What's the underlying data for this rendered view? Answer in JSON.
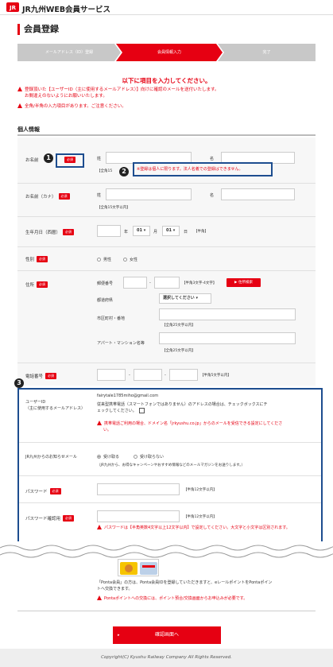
{
  "header": {
    "site_title": "JR九州WEB会員サービス"
  },
  "page": {
    "title": "会員登録"
  },
  "steps": [
    {
      "label": "メールアドレス（ID）登録"
    },
    {
      "label": "会員情報入力"
    },
    {
      "label": "完了"
    }
  ],
  "instruction": "以下に項目を入力してください。",
  "notes": [
    "登録頂いた【ユーザーID（主に使用するメールアドレス）】向けに確認のメールを送付いたします。",
    "お間違えのないようにお願いいたします。",
    "全角/半角の入力項目があります。ご注意ください。"
  ],
  "section": {
    "title": "個人情報"
  },
  "required_badge": "必須",
  "name": {
    "label": "お名前",
    "sei": "姓",
    "mei": "名",
    "hint": "【全角15",
    "warning": "※登録は個人に限ります。法人名義での登録はできません。"
  },
  "name_kana": {
    "label": "お名前（カナ）",
    "sei": "姓",
    "mei": "名",
    "hint": "【全角15文字以内】"
  },
  "birthday": {
    "label": "生年月日（西暦）",
    "year_unit": "年",
    "month": "01",
    "month_unit": "月",
    "day": "01",
    "day_unit": "日",
    "hint": "【半角】"
  },
  "gender": {
    "label": "性別",
    "male": "男性",
    "female": "女性"
  },
  "address": {
    "label": "住所",
    "postal_label": "郵便番号",
    "postal_hint": "【半角3文字-4文字】",
    "search_button": "▶ 住所検索",
    "pref_label": "都道府県",
    "pref_value": "選択してください",
    "city_label": "市区町村・番地",
    "city_hint": "【全角25文字以内】",
    "building_label": "アパート・マンション名等",
    "building_hint": "【全角25文字以内】"
  },
  "phone": {
    "label": "電話番号",
    "hint": "【半角5文字以内】"
  },
  "user_id": {
    "label_line1": "ユーザーID",
    "label_line2": "（主に使用するメールアドレス）",
    "value": "fairytale1785miho@gmail.com",
    "checkbox_text_1": "従来型携帯電話（スマートフォンではありません）のアドレスの場合は、チェックボックスにチ",
    "checkbox_text_2": "ェックしてください。",
    "warning_1": "携帯電話ご利用の場合、ドメイン名「jrkyushu.co.jp」からのメールを受信できる設定にしてくださ",
    "warning_2": "い。"
  },
  "newsletter": {
    "label": "JR九州からのお知らせメール",
    "receive": "受け取る",
    "not_receive": "受け取らない",
    "note": "（JR九州から、お得なキャンペーンやおすすめ情報などのメールマガジンをお送りします。）"
  },
  "password": {
    "label": "パスワード",
    "hint": "【半角12文字以内】"
  },
  "password_confirm": {
    "label": "パスワード確認用",
    "hint": "【半角12文字以内】",
    "warning": "パスワードは【半角英数4文字以上12文字以内】で設定してください。大文字と小文字は区別されます。"
  },
  "ponta": {
    "text_1": "「Ponta会員」の方は、Ponta会員IDを登録していただきますと、eレールポイントをPontaポイン",
    "text_2": "トへ交換できます。",
    "warning": "Pontaポイントへの交換には、ポイント預合/交換画面からお申込みが必要です。"
  },
  "callouts": [
    "1",
    "2",
    "3"
  ],
  "submit_label": "確認画面へ",
  "footer": "Copyright(C) Kyushu Railway Company All Rights Reserved.",
  "colors": {
    "accent": "#e60012",
    "callout_border": "#1d4d8f"
  }
}
